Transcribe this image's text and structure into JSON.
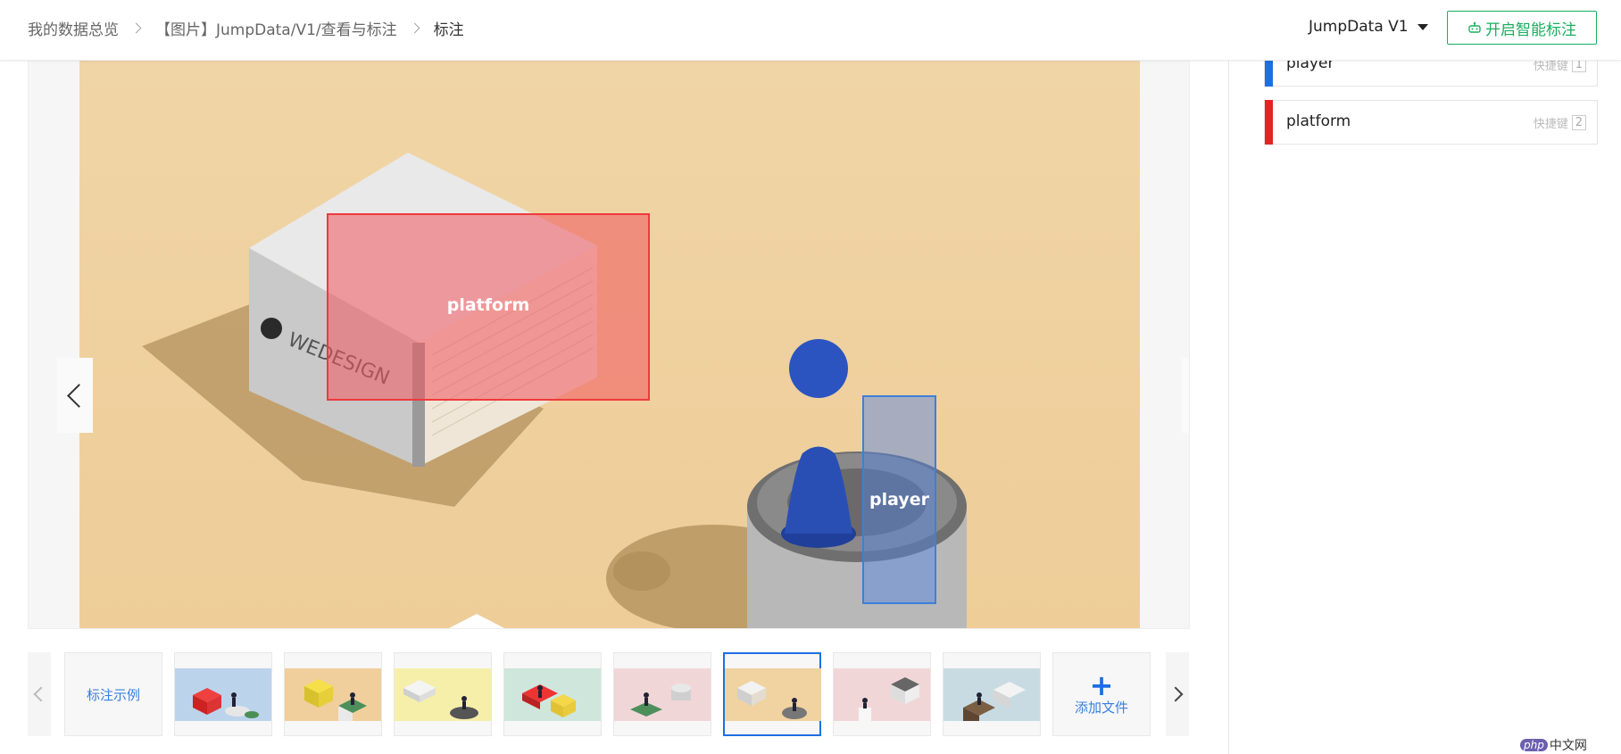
{
  "breadcrumb": {
    "items": [
      "我的数据总览",
      "【图片】JumpData/V1/查看与标注",
      "标注"
    ]
  },
  "header": {
    "version_label": "JumpData V1",
    "smart_label_button": "开启智能标注"
  },
  "annotations": [
    {
      "label": "platform",
      "color": "#ef3a3a"
    },
    {
      "label": "player",
      "color": "#3c80d8"
    }
  ],
  "thumbnails": {
    "example_label": "标注示例",
    "add_label": "添加文件",
    "count": 8,
    "selected_index": 5
  },
  "labels_panel": {
    "items": [
      {
        "name": "player",
        "shortcut_text": "快捷键",
        "key": "1",
        "color": "#1f6fe0"
      },
      {
        "name": "platform",
        "shortcut_text": "快捷键",
        "key": "2",
        "color": "#e52323"
      }
    ]
  },
  "watermark": {
    "brand": "php",
    "text": "中文网"
  }
}
